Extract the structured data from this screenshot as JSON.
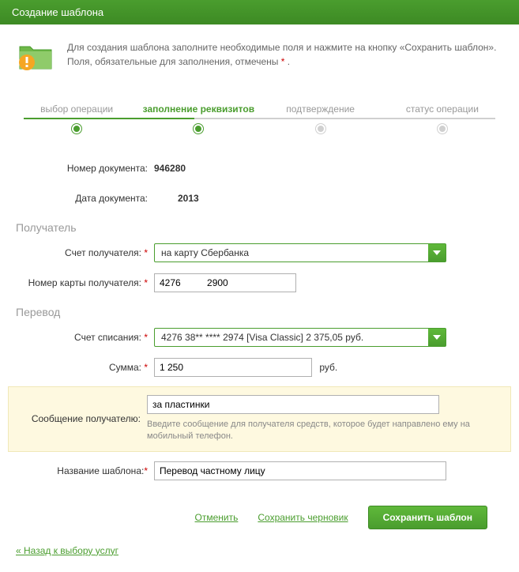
{
  "title": "Создание шаблона",
  "intro": {
    "line1": "Для создания шаблона заполните необходимые поля и нажмите на кнопку «Сохранить шаблон».",
    "line2_prefix": "Поля, обязательные для заполнения, отмечены ",
    "line2_suffix": " ."
  },
  "steps": {
    "s1": "выбор операции",
    "s2": "заполнение реквизитов",
    "s3": "подтверждение",
    "s4": "статус операции"
  },
  "fields": {
    "doc_number_label": "Номер документа:",
    "doc_number": "946280",
    "doc_date_label": "Дата документа:",
    "doc_date": "2013",
    "recipient_section": "Получатель",
    "recipient_account_label": "Счет получателя:",
    "recipient_account_value": "на карту Сбербанка",
    "card_number_label": "Номер карты получателя:",
    "card_number_value": "4276          2900",
    "transfer_section": "Перевод",
    "debit_account_label": "Счет списания:",
    "debit_account_value": "4276 38** **** 2974  [Visa Classic] 2 375,05  руб.",
    "amount_label": "Сумма:",
    "amount_value": "1 250",
    "amount_unit": "руб.",
    "message_label": "Сообщение получателю:",
    "message_value": "за пластинки",
    "message_hint": "Введите сообщение для получателя средств, которое будет направлено ему на мобильный телефон.",
    "template_name_label": "Название шаблона:",
    "template_name_value": "Перевод частному лицу"
  },
  "actions": {
    "cancel": "Отменить",
    "draft": "Сохранить черновик",
    "save": "Сохранить шаблон"
  },
  "back_link": "« Назад к выбору услуг",
  "asterisk": "*"
}
